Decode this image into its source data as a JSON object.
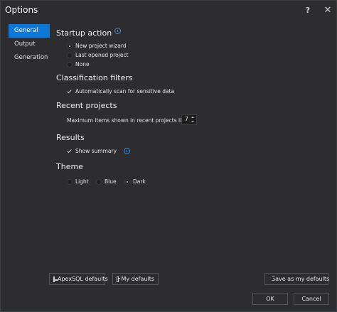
{
  "window": {
    "title": "Options",
    "help": "?",
    "close": "✕"
  },
  "sidebar": {
    "items": [
      {
        "label": "General"
      },
      {
        "label": "Output"
      },
      {
        "label": "Generation"
      }
    ]
  },
  "startup": {
    "title": "Startup action",
    "options": [
      {
        "label": "New project wizard",
        "checked": true
      },
      {
        "label": "Last opened project",
        "checked": false
      },
      {
        "label": "None",
        "checked": false
      }
    ]
  },
  "classification": {
    "title": "Classification filters",
    "auto_scan": {
      "label": "Automatically scan for sensitive data",
      "checked": true
    }
  },
  "recent": {
    "title": "Recent projects",
    "max_label": "Maximum items shown in recent projects list:",
    "max_value": "7"
  },
  "results": {
    "title": "Results",
    "show_summary": {
      "label": "Show summary",
      "checked": true
    }
  },
  "theme": {
    "title": "Theme",
    "options": [
      {
        "label": "Light",
        "checked": false
      },
      {
        "label": "Blue",
        "checked": false
      },
      {
        "label": "Dark",
        "checked": true
      }
    ]
  },
  "buttons": {
    "apex_defaults": "ApexSQL defaults",
    "my_defaults": "My defaults",
    "save_defaults": "Save as my defaults",
    "ok": "OK",
    "cancel": "Cancel"
  },
  "colors": {
    "accent": "#0e78d7",
    "background": "#2d2d30",
    "info": "#3d8ee8"
  }
}
